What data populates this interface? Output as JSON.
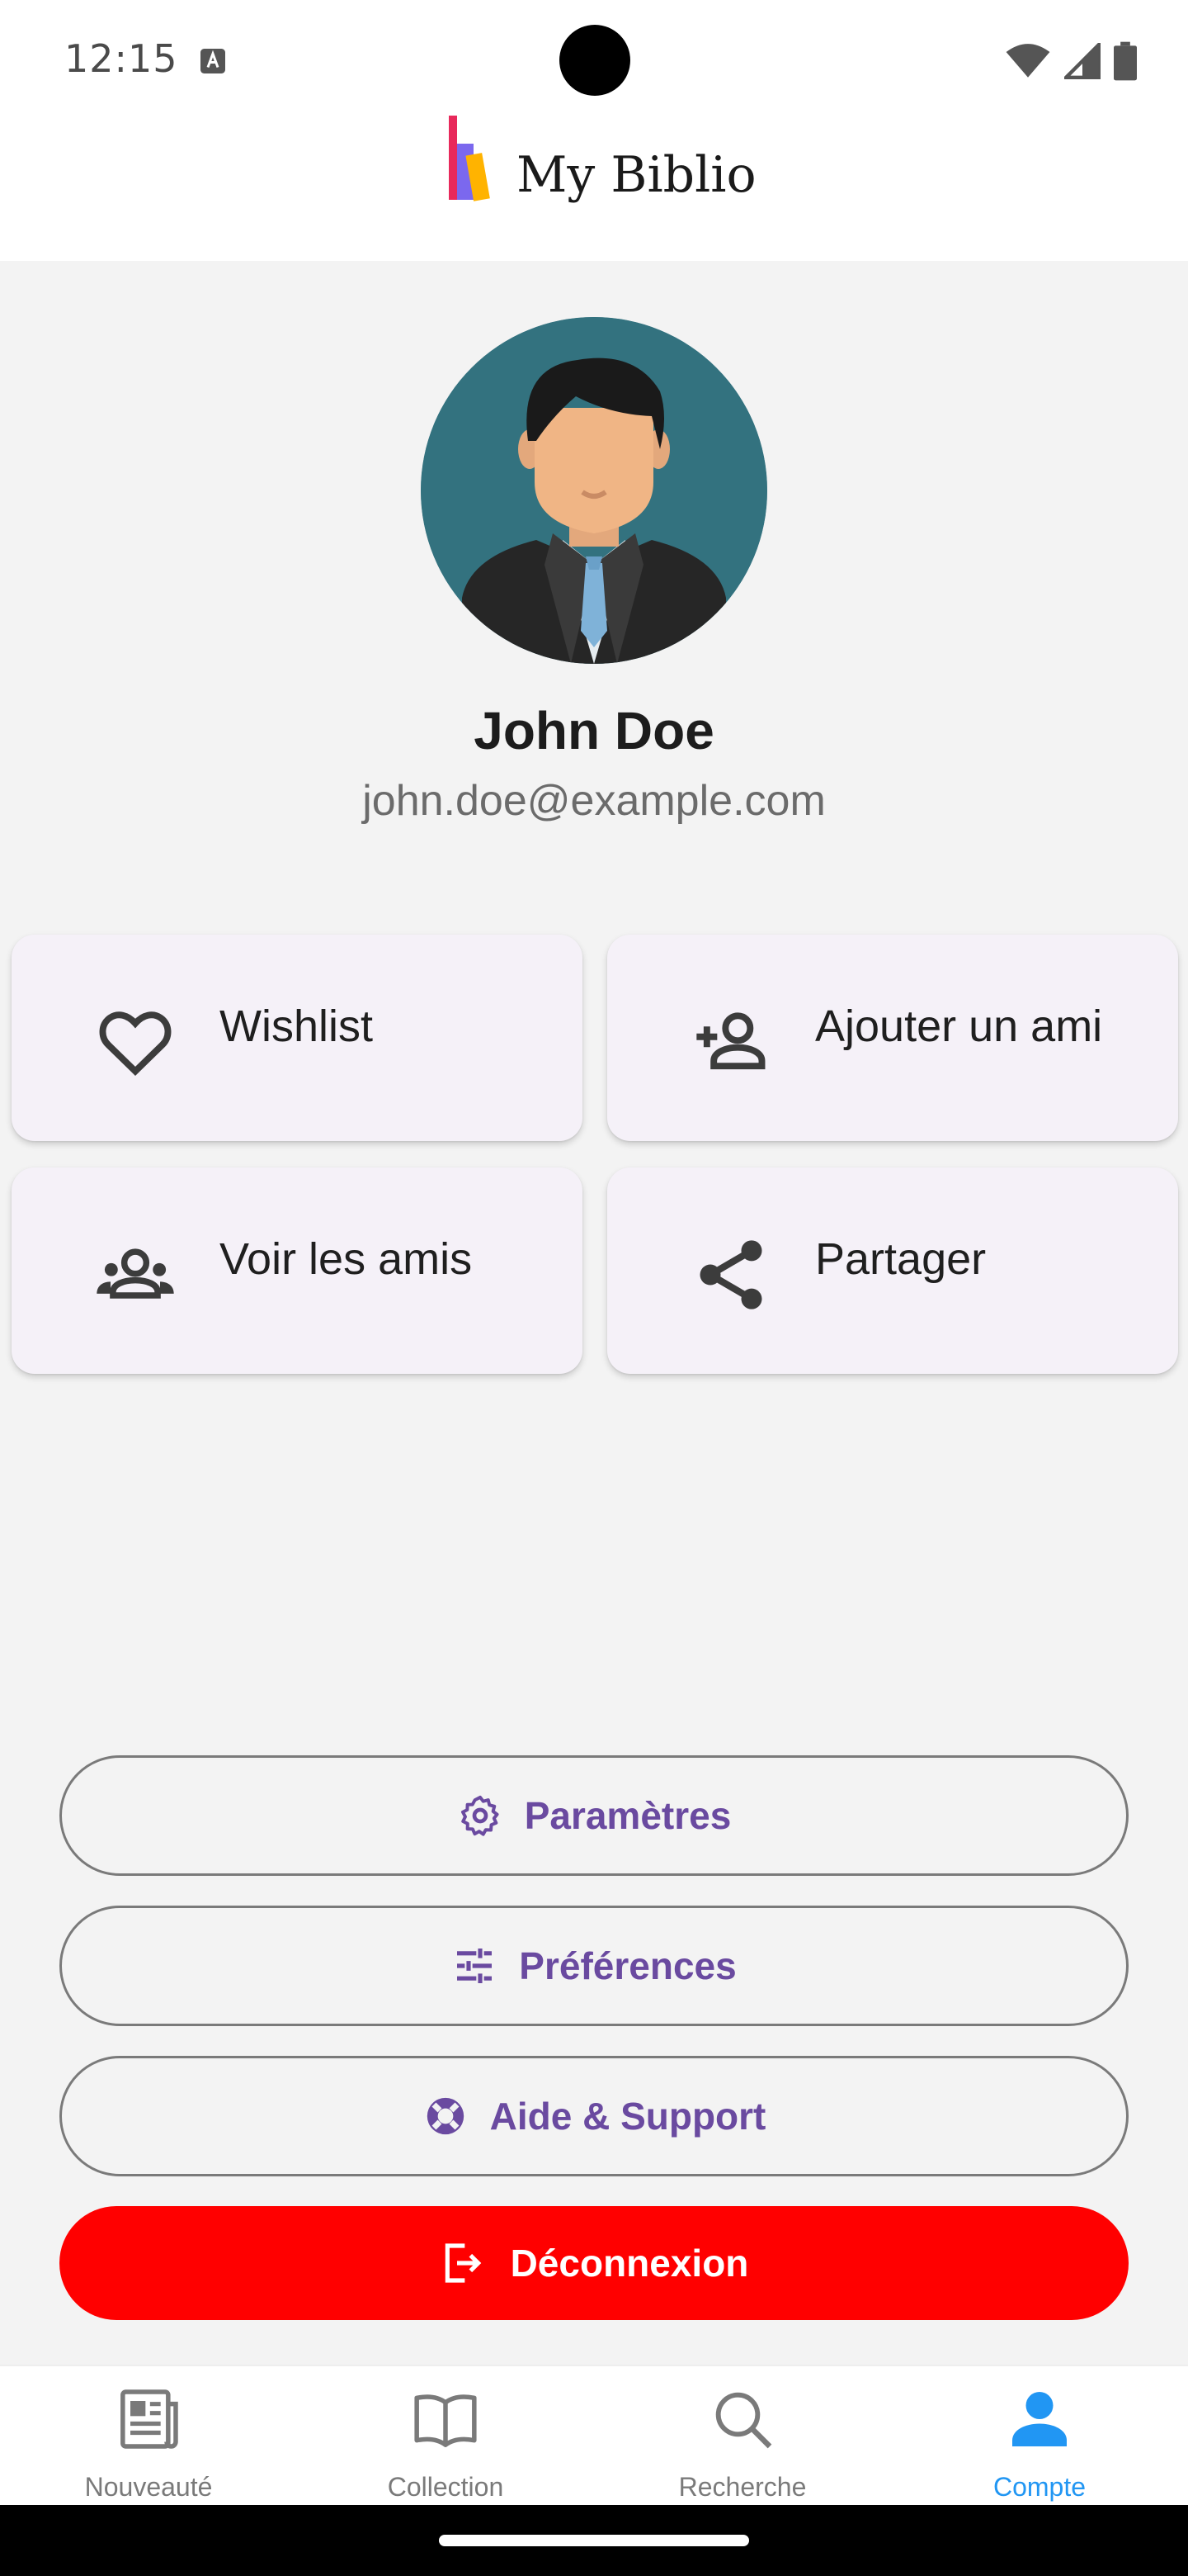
{
  "status_bar": {
    "time": "12:15",
    "icons": [
      "keyboard-a-icon",
      "wifi-icon",
      "signal-icon",
      "battery-icon"
    ]
  },
  "header": {
    "app_title": "My Biblio",
    "logo_colors": [
      "#e8295b",
      "#7b68ee",
      "#ffb300"
    ]
  },
  "profile": {
    "name": "John Doe",
    "email": "john.doe@example.com",
    "avatar_icon": "businessman-avatar"
  },
  "actions": [
    {
      "label": "Wishlist",
      "icon": "heart-outline-icon"
    },
    {
      "label": "Ajouter un ami",
      "icon": "person-add-icon"
    },
    {
      "label": "Voir les amis",
      "icon": "people-icon"
    },
    {
      "label": "Partager",
      "icon": "share-icon"
    }
  ],
  "menu": {
    "settings_label": "Paramètres",
    "preferences_label": "Préférences",
    "support_label": "Aide & Support",
    "logout_label": "Déconnexion"
  },
  "bottom_nav": {
    "items": [
      {
        "label": "Nouveauté",
        "icon": "newspaper-icon",
        "active": false
      },
      {
        "label": "Collection",
        "icon": "book-open-icon",
        "active": false
      },
      {
        "label": "Recherche",
        "icon": "search-icon",
        "active": false
      },
      {
        "label": "Compte",
        "icon": "account-icon",
        "active": true
      }
    ]
  },
  "colors": {
    "accent_purple": "#6a4aa0",
    "logout_red": "#ff0000",
    "active_blue": "#2196f3",
    "card_bg": "#f5f1f8"
  }
}
